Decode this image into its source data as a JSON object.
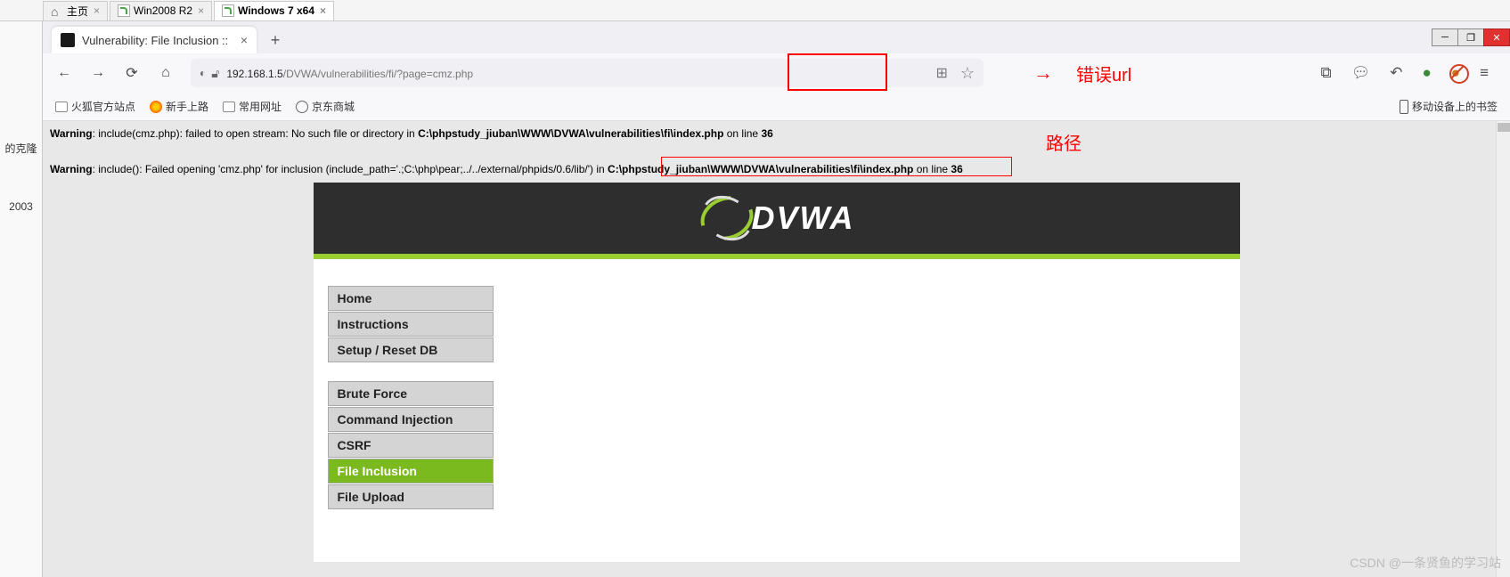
{
  "vm_tabs": {
    "home": "主页",
    "win2008": "Win2008 R2",
    "win7": "Windows 7 x64"
  },
  "left": {
    "clone": "的克隆",
    "y2003": "2003"
  },
  "browser_tab": {
    "title": "Vulnerability: File Inclusion ::"
  },
  "url": {
    "pre": "192.168.1.5",
    "mid": "/DVWA/vulnerabilities/fi/?page=",
    "param": "cmz.php"
  },
  "annot": {
    "arrow": "→",
    "err": "错误url",
    "path": "路径"
  },
  "bookmarks": {
    "b1": "火狐官方站点",
    "b2": "新手上路",
    "b3": "常用网址",
    "b4": "京东商城",
    "mobile": "移动设备上的书签"
  },
  "warn1": {
    "lbl": "Warning",
    "t1": ": include(cmz.php): failed to open stream: No such file or directory in ",
    "path": "C:\\phpstudy_jiuban\\WWW\\DVWA\\vulnerabilities\\fi\\index.php",
    "t2": " on line ",
    "line": "36"
  },
  "warn2": {
    "lbl": "Warning",
    "t1": ": include(): Failed opening 'cmz.php' for inclusion (include_path='.;C:\\php\\pear;../../external/phpids/0.6/lib/') in ",
    "path": "C:\\phpstudy_jiuban\\WWW\\DVWA\\vulnerabilities\\fi\\index.php",
    "t2": " on line ",
    "line": "36"
  },
  "logo": "DVWA",
  "menu": {
    "home": "Home",
    "inst": "Instructions",
    "setup": "Setup / Reset DB",
    "brute": "Brute Force",
    "cmd": "Command Injection",
    "csrf": "CSRF",
    "fi": "File Inclusion",
    "fu": "File Upload"
  },
  "watermark": "CSDN @一条贤鱼的学习站"
}
